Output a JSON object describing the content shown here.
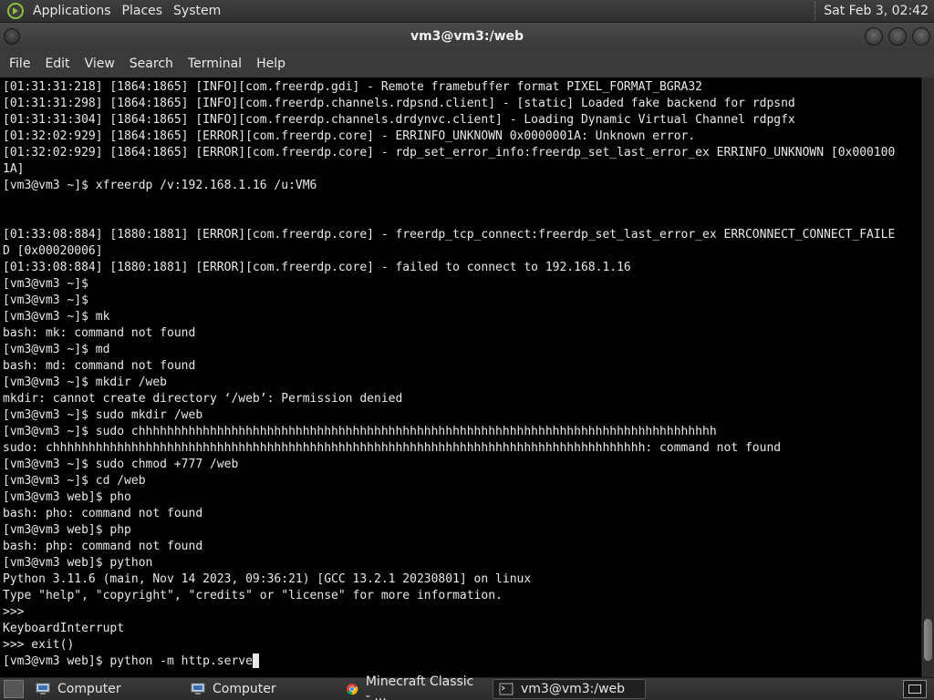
{
  "top_panel": {
    "menus": [
      "Applications",
      "Places",
      "System"
    ],
    "clock": "Sat Feb  3, 02:42"
  },
  "window": {
    "title": "vm3@vm3:/web",
    "menu": [
      "File",
      "Edit",
      "View",
      "Search",
      "Terminal",
      "Help"
    ]
  },
  "terminal": {
    "lines": [
      "[01:31:31:218] [1864:1865] [INFO][com.freerdp.gdi] - Remote framebuffer format PIXEL_FORMAT_BGRA32",
      "[01:31:31:298] [1864:1865] [INFO][com.freerdp.channels.rdpsnd.client] - [static] Loaded fake backend for rdpsnd",
      "[01:31:31:304] [1864:1865] [INFO][com.freerdp.channels.drdynvc.client] - Loading Dynamic Virtual Channel rdpgfx",
      "[01:32:02:929] [1864:1865] [ERROR][com.freerdp.core] - ERRINFO_UNKNOWN 0x0000001A: Unknown error.",
      "[01:32:02:929] [1864:1865] [ERROR][com.freerdp.core] - rdp_set_error_info:freerdp_set_last_error_ex ERRINFO_UNKNOWN [0x000100",
      "1A]",
      "[vm3@vm3 ~]$ xfreerdp /v:192.168.1.16 /u:VM6",
      "",
      "",
      "[01:33:08:884] [1880:1881] [ERROR][com.freerdp.core] - freerdp_tcp_connect:freerdp_set_last_error_ex ERRCONNECT_CONNECT_FAILE",
      "D [0x00020006]",
      "[01:33:08:884] [1880:1881] [ERROR][com.freerdp.core] - failed to connect to 192.168.1.16",
      "[vm3@vm3 ~]$",
      "[vm3@vm3 ~]$",
      "[vm3@vm3 ~]$ mk",
      "bash: mk: command not found",
      "[vm3@vm3 ~]$ md",
      "bash: md: command not found",
      "[vm3@vm3 ~]$ mkdir /web",
      "mkdir: cannot create directory ‘/web’: Permission denied",
      "[vm3@vm3 ~]$ sudo mkdir /web",
      "[vm3@vm3 ~]$ sudo chhhhhhhhhhhhhhhhhhhhhhhhhhhhhhhhhhhhhhhhhhhhhhhhhhhhhhhhhhhhhhhhhhhhhhhhhhhhhhhhh",
      "sudo: chhhhhhhhhhhhhhhhhhhhhhhhhhhhhhhhhhhhhhhhhhhhhhhhhhhhhhhhhhhhhhhhhhhhhhhhhhhhhhhhhhh: command not found",
      "[vm3@vm3 ~]$ sudo chmod +777 /web",
      "[vm3@vm3 ~]$ cd /web",
      "[vm3@vm3 web]$ pho",
      "bash: pho: command not found",
      "[vm3@vm3 web]$ php",
      "bash: php: command not found",
      "[vm3@vm3 web]$ python",
      "Python 3.11.6 (main, Nov 14 2023, 09:36:21) [GCC 13.2.1 20230801] on linux",
      "Type \"help\", \"copyright\", \"credits\" or \"license\" for more information.",
      ">>>",
      "KeyboardInterrupt",
      ">>> exit()"
    ],
    "current_input": "[vm3@vm3 web]$ python -m http.serve"
  },
  "taskbar": {
    "tasks": [
      {
        "label": "Computer",
        "icon": "computer-icon",
        "active": false
      },
      {
        "label": "Computer",
        "icon": "computer-icon",
        "active": false
      },
      {
        "label": "Minecraft Classic - ...",
        "icon": "chrome-icon",
        "active": false
      },
      {
        "label": "vm3@vm3:/web",
        "icon": "terminal-icon",
        "active": true
      }
    ]
  },
  "colors": {
    "terminal_bg": "#000000",
    "terminal_fg": "#e8e8e8",
    "panel_bg": "#333333"
  }
}
